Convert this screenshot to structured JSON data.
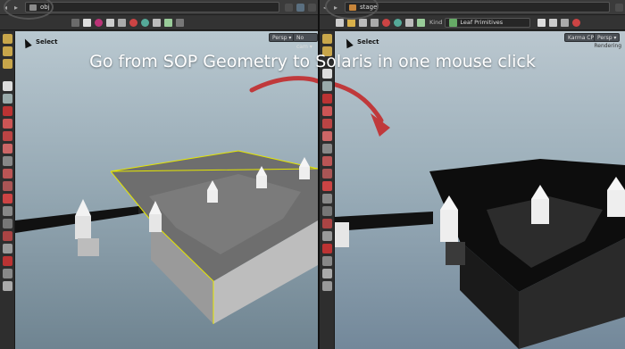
{
  "banner": {
    "text": "Go from SOP Geometry to Solaris in one mouse click"
  },
  "left_pane": {
    "path": "obj",
    "select_label": "Select",
    "camera_persp": "Persp ▾",
    "camera_nocam": "No cam ▾"
  },
  "right_pane": {
    "path": "stage",
    "kind_label": "Kind",
    "kind_value": "Leaf Primitives",
    "select_label": "Select",
    "renderer_label": "Karma CPU",
    "camera_persp": "Persp ▾",
    "rendering_label": "Rendering"
  },
  "nav": {
    "back": "◂",
    "forward": "▸"
  },
  "colors": {
    "accent_arrow": "#c0393b",
    "selection_outline": "#e5e600",
    "panel_bg": "#333333",
    "sky_top": "#b9c8d0",
    "sky_bottom": "#6f8491"
  },
  "icons": {
    "path_icon": "folder-icon",
    "kind_icon": "leaf-primitives-icon"
  }
}
